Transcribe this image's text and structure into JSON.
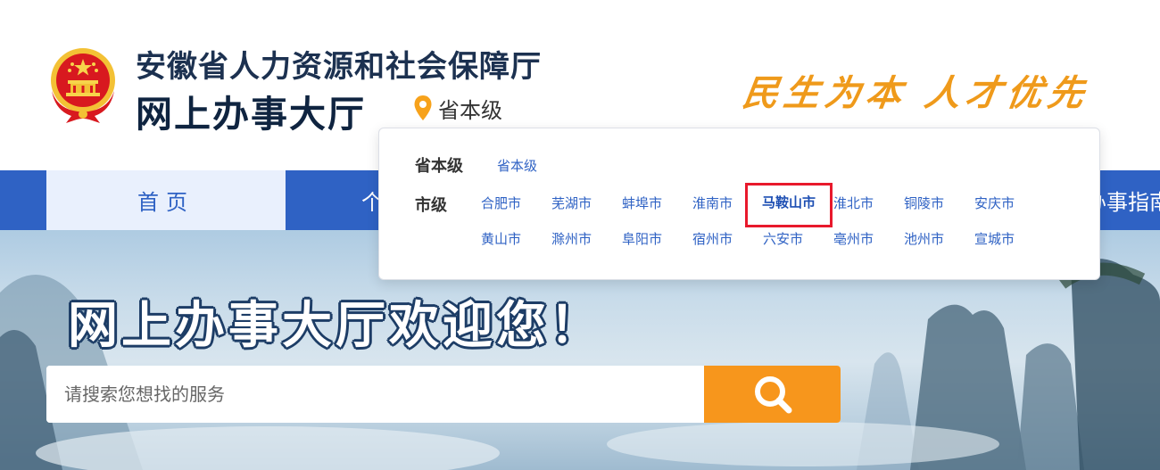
{
  "header": {
    "title_line1": "安徽省人力资源和社会保障厅",
    "title_line2": "网上办事大厅",
    "location_label": "省本级",
    "slogan": "民生为本 人才优先",
    "emblem_icon": "national-emblem-icon",
    "location_icon": "location-pin-icon"
  },
  "nav": {
    "home": "首页",
    "personal_partial": "个",
    "guide_partial": "办事指南",
    "accent_color": "#2f62c4",
    "home_bg": "#e9f0fd"
  },
  "hero": {
    "welcome": "网上办事大厅欢迎您！",
    "search_placeholder": "请搜索您想找的服务",
    "search_icon": "search-icon",
    "search_button_color": "#f7961c"
  },
  "dropdown": {
    "province_label": "省本级",
    "province_link": "省本级",
    "city_label": "市级",
    "cities_row1": [
      "合肥市",
      "芜湖市",
      "蚌埠市",
      "淮南市",
      "马鞍山市",
      "淮北市",
      "铜陵市",
      "安庆市"
    ],
    "cities_row2": [
      "黄山市",
      "滁州市",
      "阜阳市",
      "宿州市",
      "六安市",
      "亳州市",
      "池州市",
      "宣城市"
    ],
    "selected_city": "马鞍山市",
    "selection_border_color": "#e8192c"
  }
}
